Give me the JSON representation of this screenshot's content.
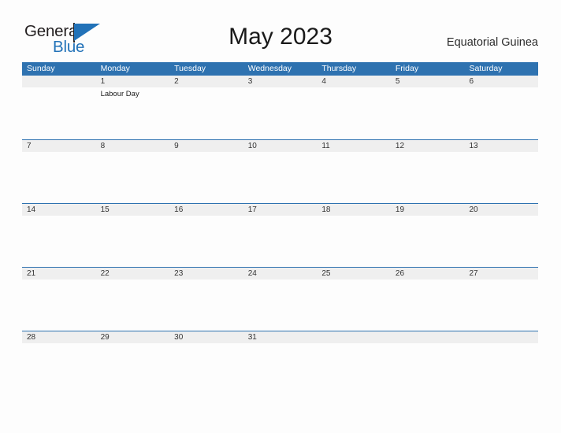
{
  "brand": {
    "word_one": "General",
    "word_two": "Blue",
    "flag_icon": "blue-triangle-flag",
    "accent_color": "#2272b8"
  },
  "header": {
    "title": "May 2023",
    "subtitle": "Equatorial Guinea"
  },
  "colors": {
    "header_blue": "#2e72b0",
    "row_band_gray": "#efefef",
    "page_background": "#fdfdfd",
    "brand_blue": "#2272b8"
  },
  "calendar": {
    "day_headers": [
      "Sunday",
      "Monday",
      "Tuesday",
      "Wednesday",
      "Thursday",
      "Friday",
      "Saturday"
    ],
    "weeks": [
      [
        {
          "date": "",
          "events": []
        },
        {
          "date": "1",
          "events": [
            "Labour Day"
          ]
        },
        {
          "date": "2",
          "events": []
        },
        {
          "date": "3",
          "events": []
        },
        {
          "date": "4",
          "events": []
        },
        {
          "date": "5",
          "events": []
        },
        {
          "date": "6",
          "events": []
        }
      ],
      [
        {
          "date": "7",
          "events": []
        },
        {
          "date": "8",
          "events": []
        },
        {
          "date": "9",
          "events": []
        },
        {
          "date": "10",
          "events": []
        },
        {
          "date": "11",
          "events": []
        },
        {
          "date": "12",
          "events": []
        },
        {
          "date": "13",
          "events": []
        }
      ],
      [
        {
          "date": "14",
          "events": []
        },
        {
          "date": "15",
          "events": []
        },
        {
          "date": "16",
          "events": []
        },
        {
          "date": "17",
          "events": []
        },
        {
          "date": "18",
          "events": []
        },
        {
          "date": "19",
          "events": []
        },
        {
          "date": "20",
          "events": []
        }
      ],
      [
        {
          "date": "21",
          "events": []
        },
        {
          "date": "22",
          "events": []
        },
        {
          "date": "23",
          "events": []
        },
        {
          "date": "24",
          "events": []
        },
        {
          "date": "25",
          "events": []
        },
        {
          "date": "26",
          "events": []
        },
        {
          "date": "27",
          "events": []
        }
      ],
      [
        {
          "date": "28",
          "events": []
        },
        {
          "date": "29",
          "events": []
        },
        {
          "date": "30",
          "events": []
        },
        {
          "date": "31",
          "events": []
        },
        {
          "date": "",
          "events": []
        },
        {
          "date": "",
          "events": []
        },
        {
          "date": "",
          "events": []
        }
      ]
    ]
  }
}
